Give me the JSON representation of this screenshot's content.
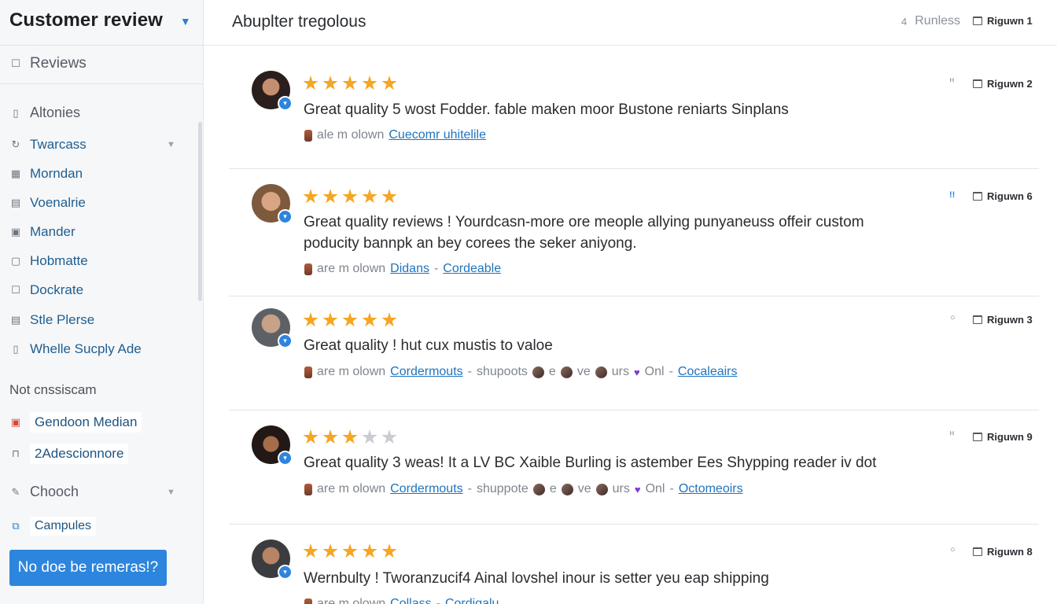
{
  "sidebar": {
    "title": "Customer review",
    "reviews_label": "Reviews",
    "items": [
      {
        "label": "Altonies",
        "icon": "trash-icon"
      },
      {
        "label": "Twarcass",
        "icon": "refresh-icon"
      },
      {
        "label": "Morndan",
        "icon": "grid-icon"
      },
      {
        "label": "Voenalrie",
        "icon": "doc-icon"
      },
      {
        "label": "Mander",
        "icon": "calendar-icon"
      },
      {
        "label": "Hobmatte",
        "icon": "page-icon"
      },
      {
        "label": "Dockrate",
        "icon": "square-icon"
      },
      {
        "label": "Stle Plerse",
        "icon": "list-icon"
      },
      {
        "label": "Whelle Sucply Ade",
        "icon": "file-icon"
      }
    ],
    "section_label": "Not cnssiscam",
    "section_items": [
      {
        "label": "Gendoon Median",
        "icon": "image-icon"
      },
      {
        "label": "2Adescionnore",
        "icon": "lock-icon"
      },
      {
        "label": "Chooch",
        "icon": "edit-icon"
      },
      {
        "label": "Campules",
        "icon": "external-icon"
      }
    ],
    "cta_label": "No doe be remeras!?"
  },
  "header": {
    "title": "Abuplter tregolous",
    "runless_num": "4",
    "runless_label": "Runless",
    "tag": "Riguwn 1"
  },
  "reviews": [
    {
      "rating": 5,
      "text": "Great quality 5 wost Fodder. fable maken moor Bustone reniarts Sinplans",
      "meta_text": "ale m olown",
      "links": [
        "Cuecomr uhitelile"
      ],
      "tag": "Riguwn 2",
      "mini": "ᴴ"
    },
    {
      "rating": 5,
      "text": "Great quality reviews ! Yourdcasn-more ore meople allying punyaneuss offeir custom poducity bannpk an bey corees the seker aniyong.",
      "meta_text": "are m olown",
      "links": [
        "Didans",
        "Cordeable"
      ],
      "tag": "Riguwn 6",
      "mini": "!!"
    },
    {
      "rating": 5,
      "text": "Great quality ! hut cux mustis to valoe",
      "meta_text": "are m olown",
      "links": [
        "Cordermouts",
        "Cocaleairs"
      ],
      "extra": [
        "shupoots",
        "e",
        "ve",
        "urs",
        "Onl"
      ],
      "tag": "Riguwn 3",
      "mini": "○"
    },
    {
      "rating": 3,
      "text": "Great quality 3 weas! It a LV BC Xaible Burling is astember Ees Shypping reader iv dot",
      "meta_text": "are m olown",
      "links": [
        "Cordermouts",
        "Octomeoirs"
      ],
      "extra": [
        "shuppote",
        "e",
        "ve",
        "urs",
        "Onl"
      ],
      "tag": "Riguwn 9",
      "mini": "ᴴ"
    },
    {
      "rating": 5,
      "text": "Wernbulty ! Tworanzucif4 Ainal lovshel inour is setter yeu eap shipping",
      "meta_text": "are m olown",
      "links": [
        "Collass",
        "Cordigalu"
      ],
      "tag": "Riguwn 8",
      "mini": "○"
    }
  ],
  "colors": {
    "accent": "#2d85dd",
    "star": "#f5a623",
    "link": "#1f74be"
  }
}
